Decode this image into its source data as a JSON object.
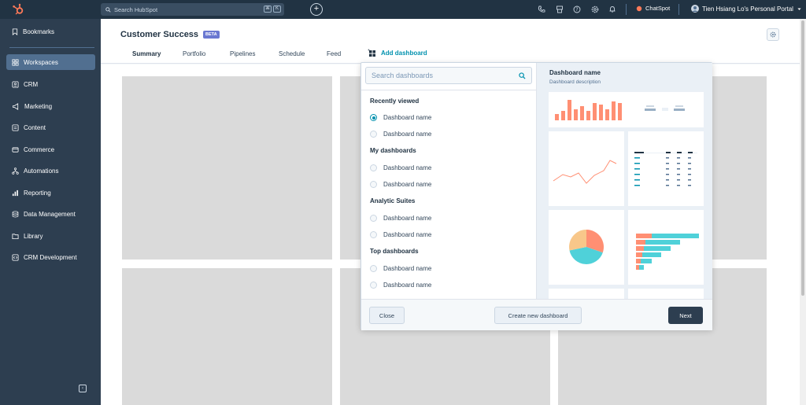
{
  "topbar": {
    "search_placeholder": "Search HubSpot",
    "kbd_keys": [
      "⌘",
      "K"
    ],
    "chatspot_label": "ChatSpot",
    "portal_label": "Tien Hsiang Lo's Personal Portal"
  },
  "sidebar": {
    "items": [
      {
        "label": "Bookmarks",
        "icon": "bookmark-icon"
      },
      {
        "label": "Workspaces",
        "icon": "grid-icon"
      },
      {
        "label": "CRM",
        "icon": "crm-icon"
      },
      {
        "label": "Marketing",
        "icon": "megaphone-icon"
      },
      {
        "label": "Content",
        "icon": "content-icon"
      },
      {
        "label": "Commerce",
        "icon": "commerce-icon"
      },
      {
        "label": "Automations",
        "icon": "automation-icon"
      },
      {
        "label": "Reporting",
        "icon": "bar-chart-icon"
      },
      {
        "label": "Data Management",
        "icon": "database-icon"
      },
      {
        "label": "Library",
        "icon": "folder-icon"
      },
      {
        "label": "CRM Development",
        "icon": "code-icon"
      }
    ]
  },
  "header": {
    "title": "Customer Success",
    "badge": "BETA",
    "tabs": [
      "Summary",
      "Portfolio",
      "Pipelines",
      "Schedule",
      "Feed"
    ],
    "add_dashboard": "Add dashboard"
  },
  "panel": {
    "search_placeholder": "Search dashboards",
    "groups": [
      {
        "heading": "Recently viewed",
        "options": [
          "Dashboard name",
          "Dashboard name"
        ]
      },
      {
        "heading": "My dashboards",
        "options": [
          "Dashboard name",
          "Dashboard name"
        ]
      },
      {
        "heading": "Analytic Suites",
        "options": [
          "Dashboard name",
          "Dashboard name"
        ]
      },
      {
        "heading": "Top dashboards",
        "options": [
          "Dashboard name",
          "Dashboard name"
        ]
      }
    ],
    "preview_name": "Dashboard name",
    "preview_description": "Dashboard description",
    "close_label": "Close",
    "create_label": "Create new dashboard",
    "next_label": "Next"
  },
  "colors": {
    "nav": "#2d3e50",
    "topbar": "#213343",
    "accent": "#0091ae",
    "coral": "#ff8f73",
    "teal": "#4fd1d9",
    "peach": "#f8c78a"
  }
}
